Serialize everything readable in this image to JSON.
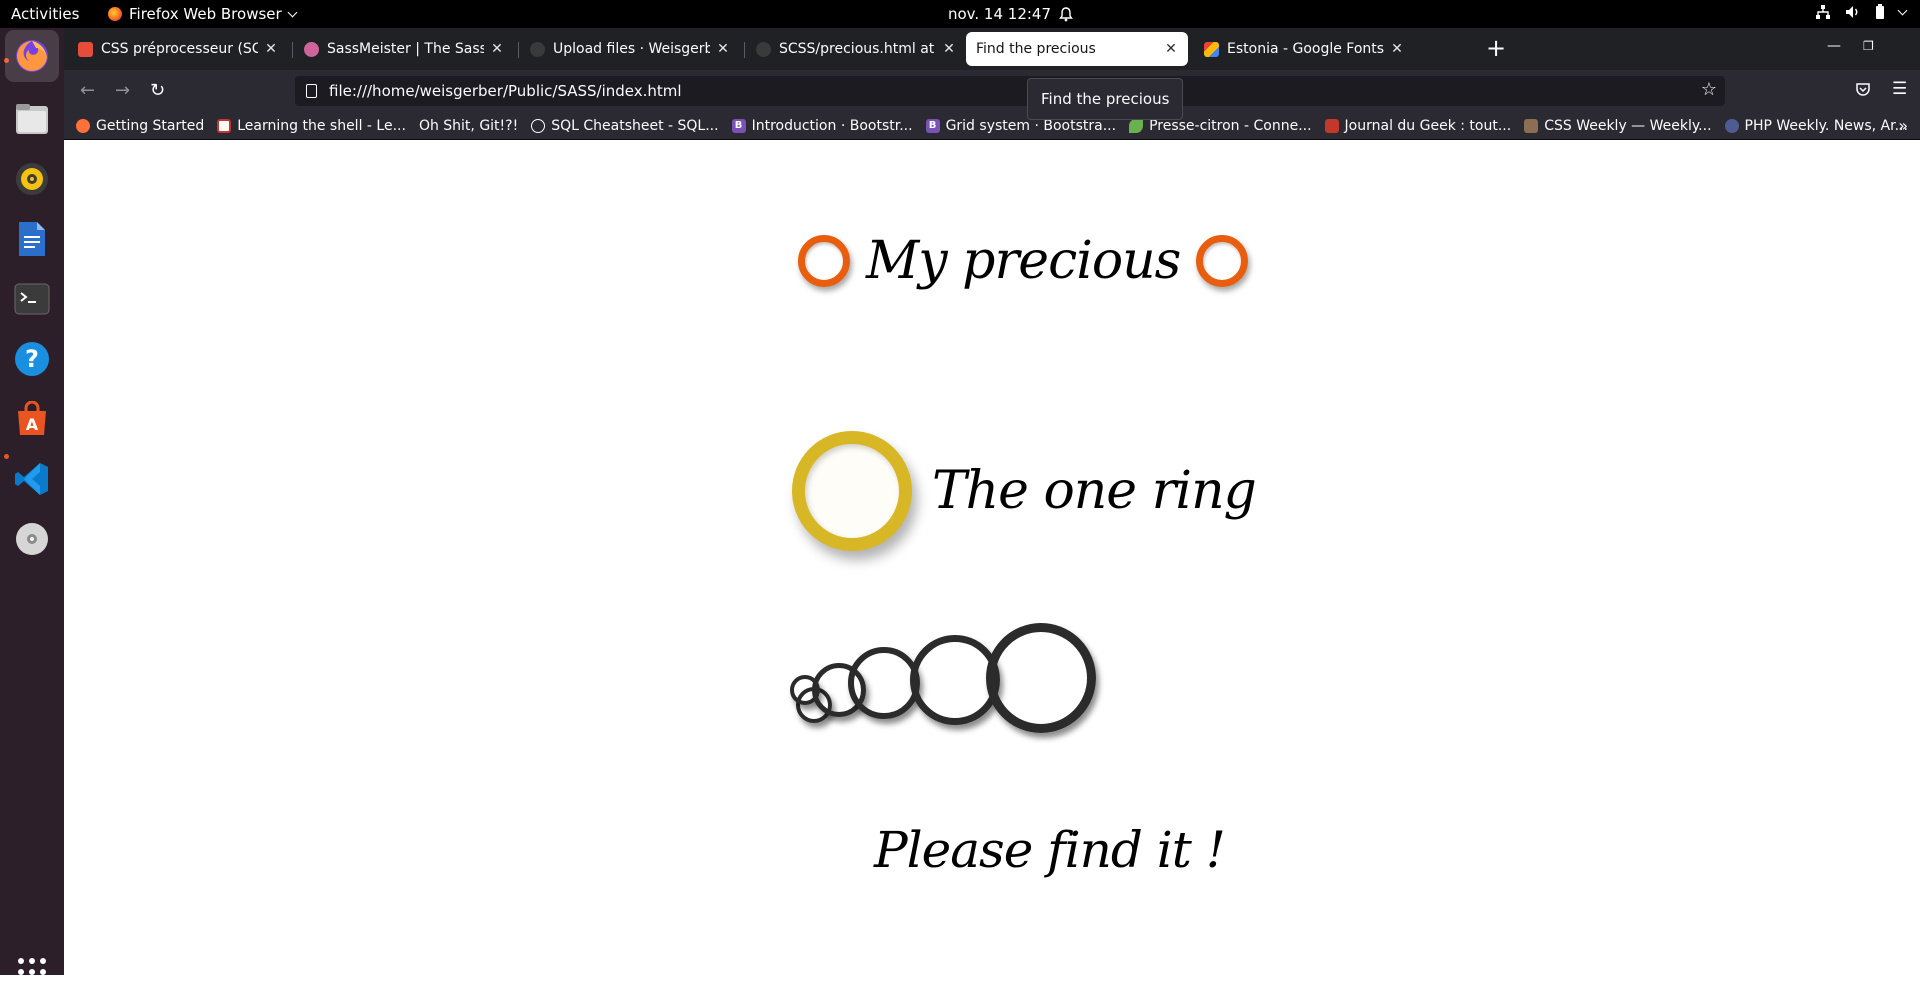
{
  "system_bar": {
    "activities": "Activities",
    "app_name": "Firefox Web Browser",
    "datetime": "nov. 14  12:47"
  },
  "dock": {
    "apps": [
      "firefox-icon",
      "files-icon",
      "rhythmbox-icon",
      "libreoffice-writer-icon",
      "terminal-icon",
      "help-icon",
      "app-center-icon",
      "vscode-icon",
      "disc-icon"
    ],
    "show_apps": "show-applications-icon"
  },
  "browser": {
    "tabs": [
      {
        "title": "CSS préprocesseur (SCSS)",
        "color": "#e64c3c"
      },
      {
        "title": "SassMeister | The Sass Playground",
        "color": "#cf649a"
      },
      {
        "title": "Upload files · Weisgerber",
        "color": "#3a3a3a"
      },
      {
        "title": "SCSS/precious.html at main",
        "color": "#3a3a3a"
      },
      {
        "title": "Find the precious",
        "color": "#ffffff"
      },
      {
        "title": "Estonia - Google Fonts",
        "color": "#ea4335"
      }
    ],
    "active_tab_index": 4,
    "url": "file:///home/weisgerber/Public/SASS/index.html",
    "tooltip": "Find the precious",
    "bookmarks": [
      {
        "label": "Getting Started",
        "color": "#ff7139"
      },
      {
        "label": "Learning the shell - Le...",
        "color": "#c0392b"
      },
      {
        "label": "Oh Shit, Git!?!",
        "color": "#2b2a33"
      },
      {
        "label": "SQL Cheatsheet - SQL...",
        "color": "#5b5b66"
      },
      {
        "label": "Introduction · Bootstr...",
        "color": "#7952b3"
      },
      {
        "label": "Grid system · Bootstra...",
        "color": "#7952b3"
      },
      {
        "label": "Presse-citron - Conne...",
        "color": "#6ab04c"
      },
      {
        "label": "Journal du Geek : tout...",
        "color": "#c0392b"
      },
      {
        "label": "CSS Weekly — Weekly...",
        "color": "#8e6e53"
      },
      {
        "label": "PHP Weekly. News, Ar...",
        "color": "#4f5b93"
      }
    ]
  },
  "page": {
    "heading": "My precious",
    "subheading": "The one ring",
    "footer": "Please find it !",
    "colors": {
      "orange_ring": "#e85d0e",
      "gold_ring": "#d8b726",
      "dark_ring": "#2b2b2b"
    }
  }
}
